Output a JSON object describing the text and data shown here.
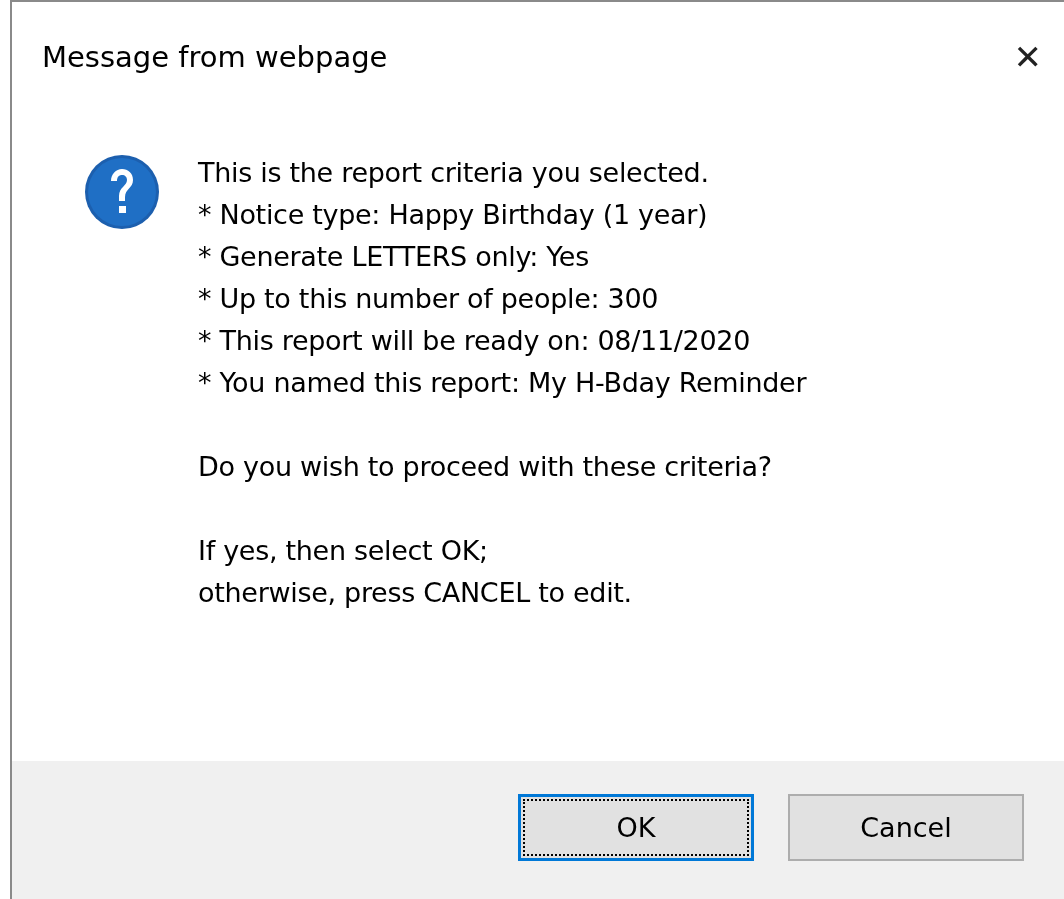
{
  "window": {
    "title": "Message from webpage",
    "close": "✕"
  },
  "message": {
    "paragraphs": [
      [
        "This is the report criteria you selected.",
        "* Notice type: Happy Birthday (1 year)",
        "* Generate LETTERS only: Yes",
        "* Up to this number of people: 300",
        "* This report will be ready on: 08/11/2020",
        "* You named this report: My H-Bday Reminder"
      ],
      [
        "Do you wish to proceed with these criteria?"
      ],
      [
        "If yes, then select OK;",
        "otherwise, press CANCEL to edit."
      ]
    ]
  },
  "buttons": [
    {
      "label": "OK",
      "selected": true
    },
    {
      "label": "Cancel",
      "selected": false
    }
  ]
}
